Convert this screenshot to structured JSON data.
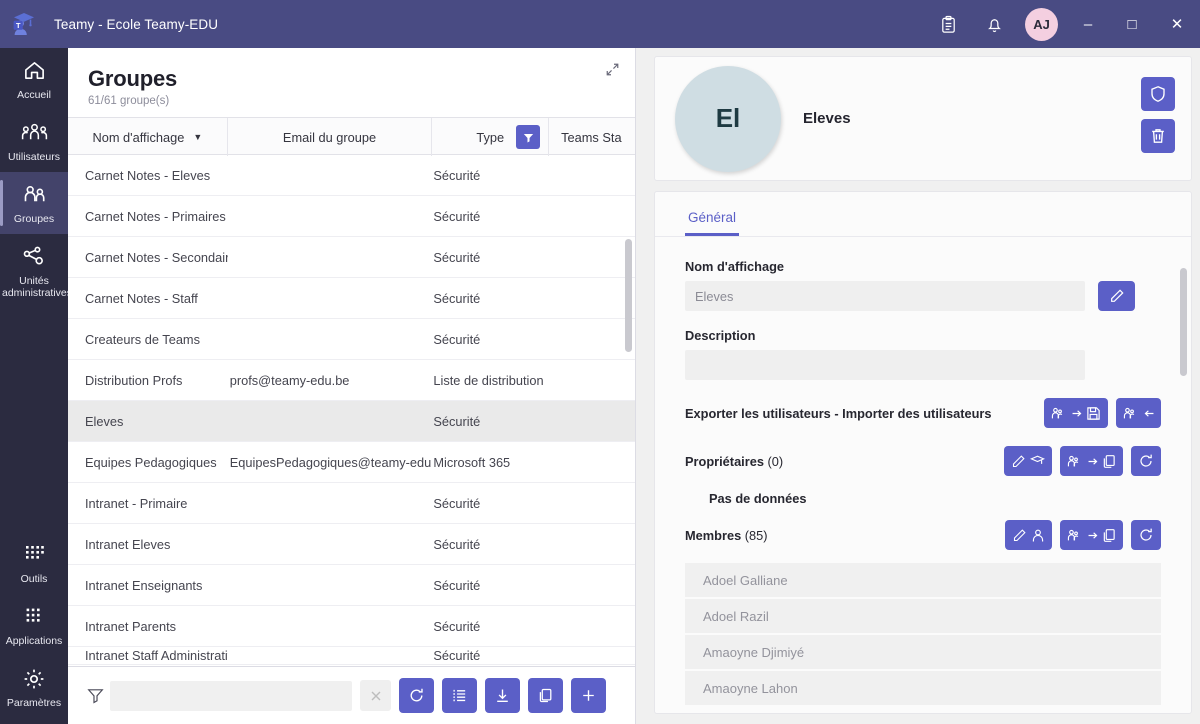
{
  "titlebar": {
    "app_title": "Teamy - Ecole Teamy-EDU",
    "logo_letter": "T",
    "icons": [
      "clipboard-icon",
      "bell-icon"
    ],
    "avatar_initials": "AJ",
    "minimize": "–",
    "maximize": "□",
    "close": "✕"
  },
  "rail": {
    "items": [
      {
        "label": "Accueil",
        "icon": "home-icon",
        "active": false
      },
      {
        "label": "Utilisateurs",
        "icon": "users-icon",
        "active": false
      },
      {
        "label": "Groupes",
        "icon": "group-icon",
        "active": true
      },
      {
        "label": "Unités administratives",
        "icon": "org-units-icon",
        "active": false
      }
    ],
    "bottom_items": [
      {
        "label": "Outils",
        "icon": "grid-icon"
      },
      {
        "label": "Applications",
        "icon": "apps-icon"
      },
      {
        "label": "Paramètres",
        "icon": "gear-icon"
      }
    ]
  },
  "list_panel": {
    "title": "Groupes",
    "count_text": "61/61 groupe(s)",
    "expand_icon": "expand-arrow-icon",
    "columns": [
      {
        "label": "Nom d'affichage",
        "sorted": true,
        "sort_glyph": "▼"
      },
      {
        "label": "Email du groupe",
        "sorted": false
      },
      {
        "label": "Type",
        "sorted": false,
        "has_filter": true
      },
      {
        "label": "Teams Sta",
        "sorted": false
      }
    ],
    "rows": [
      {
        "name": "Carnet Notes - Eleves",
        "email": "",
        "type": "Sécurité",
        "teams": "",
        "selected": false
      },
      {
        "name": "Carnet Notes - Primaires",
        "email": "",
        "type": "Sécurité",
        "teams": "",
        "selected": false
      },
      {
        "name": "Carnet Notes - Secondaires",
        "email": "",
        "type": "Sécurité",
        "teams": "",
        "selected": false
      },
      {
        "name": "Carnet Notes - Staff",
        "email": "",
        "type": "Sécurité",
        "teams": "",
        "selected": false
      },
      {
        "name": "Createurs de Teams",
        "email": "",
        "type": "Sécurité",
        "teams": "",
        "selected": false
      },
      {
        "name": "Distribution Profs",
        "email": "profs@teamy-edu.be",
        "type": "Liste de distribution",
        "teams": "",
        "selected": false
      },
      {
        "name": "Eleves",
        "email": "",
        "type": "Sécurité",
        "teams": "",
        "selected": true
      },
      {
        "name": "Equipes Pedagogiques",
        "email": "EquipesPedagogiques@teamy-edu.be",
        "type": "Microsoft 365",
        "teams": "",
        "selected": false
      },
      {
        "name": "Intranet - Primaire",
        "email": "",
        "type": "Sécurité",
        "teams": "",
        "selected": false
      },
      {
        "name": "Intranet Eleves",
        "email": "",
        "type": "Sécurité",
        "teams": "",
        "selected": false
      },
      {
        "name": "Intranet Enseignants",
        "email": "",
        "type": "Sécurité",
        "teams": "",
        "selected": false
      },
      {
        "name": "Intranet Parents",
        "email": "",
        "type": "Sécurité",
        "teams": "",
        "selected": false
      },
      {
        "name": "Intranet Staff Administratif",
        "email": "",
        "type": "Sécurité",
        "teams": "",
        "selected": false
      }
    ],
    "toolbar": {
      "funnel_icon": "filter-funnel-icon",
      "filter_value": "",
      "filter_placeholder": "",
      "clear_label": "✕",
      "buttons": [
        {
          "name": "refresh-button",
          "icon": "refresh-icon"
        },
        {
          "name": "list-view-button",
          "icon": "list-icon"
        },
        {
          "name": "download-button",
          "icon": "download-icon"
        },
        {
          "name": "copy-button",
          "icon": "copy-icon"
        },
        {
          "name": "add-button",
          "icon": "plus-icon"
        }
      ]
    }
  },
  "detail": {
    "avatar_initials": "El",
    "group_name": "Eleves",
    "header_buttons": [
      {
        "name": "security-button",
        "icon": "shield-icon"
      },
      {
        "name": "delete-button",
        "icon": "trash-icon"
      }
    ],
    "tabs": [
      {
        "label": "Général",
        "active": true
      }
    ],
    "display_name_label": "Nom d'affichage",
    "display_name_value": "Eleves",
    "edit_display_name_icon": "pencil-icon",
    "description_label": "Description",
    "description_value": "",
    "export_import_label": "Exporter les utilisateurs - Importer des utilisateurs",
    "export_icon": "export-users-icon",
    "import_icon": "import-users-icon",
    "owners_label": "Propriétaires",
    "owners_count": "(0)",
    "owners_empty": "Pas de données",
    "members_label": "Membres",
    "members_count": "(85)",
    "members": [
      "Adoel Galliane",
      "Adoel Razil",
      "Amaoyne Djimiyé",
      "Amaoyne Lahon"
    ]
  },
  "colors": {
    "titlebar": "#494b83",
    "rail": "#2b2b40",
    "rail_active": "#43436a",
    "accent": "#5b5fc7",
    "avatar_bg": "#cfdde3",
    "user_avatar_bg": "#f4cfe0",
    "selected_row": "#eaeaea"
  }
}
